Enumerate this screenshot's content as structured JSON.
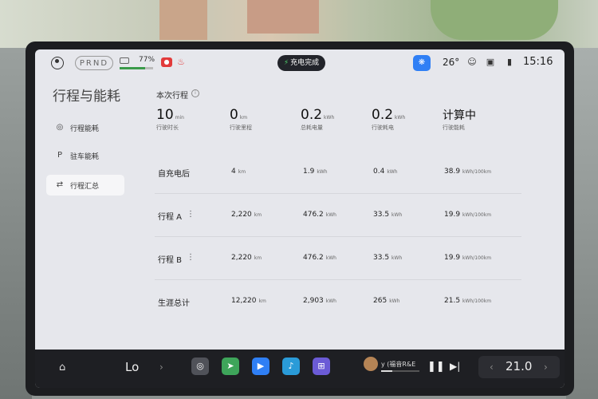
{
  "status_bar": {
    "gear": "PRND",
    "battery_percent": "77%",
    "battery_level": 0.77,
    "charge_status": "充电完成",
    "temperature": "26°",
    "time": "15:16",
    "accent_color": "#2f7ff5"
  },
  "sidebar": {
    "title": "行程与能耗",
    "items": [
      {
        "label": "行程能耗",
        "icon": "steering-wheel-icon"
      },
      {
        "label": "驻车能耗",
        "icon": "parking-icon"
      },
      {
        "label": "行程汇总",
        "icon": "swap-icon",
        "active": true
      }
    ]
  },
  "current_trip": {
    "title": "本次行程",
    "stats": [
      {
        "value": "10",
        "unit": "min",
        "label": "行驶时长"
      },
      {
        "value": "0",
        "unit": "km",
        "label": "行驶里程"
      },
      {
        "value": "0.2",
        "unit": "kWh",
        "label": "总耗电量"
      },
      {
        "value": "0.2",
        "unit": "kWh",
        "label": "行驶耗电"
      },
      {
        "value": "计算中",
        "unit": "",
        "label": "行驶能耗"
      }
    ]
  },
  "summary_rows": [
    {
      "name": "自充电后",
      "has_menu": false,
      "distance": "4",
      "distance_unit": "km",
      "energy": "1.9",
      "energy_unit": "kWh",
      "drive": "0.4",
      "drive_unit": "kWh",
      "rate": "38.9",
      "rate_unit": "kWh/100km"
    },
    {
      "name": "行程 A",
      "has_menu": true,
      "distance": "2,220",
      "distance_unit": "km",
      "energy": "476.2",
      "energy_unit": "kWh",
      "drive": "33.5",
      "drive_unit": "kWh",
      "rate": "19.9",
      "rate_unit": "kWh/100km"
    },
    {
      "name": "行程 B",
      "has_menu": true,
      "distance": "2,220",
      "distance_unit": "km",
      "energy": "476.2",
      "energy_unit": "kWh",
      "drive": "33.5",
      "drive_unit": "kWh",
      "rate": "19.9",
      "rate_unit": "kWh/100km"
    },
    {
      "name": "生涯总计",
      "has_menu": false,
      "distance": "12,220",
      "distance_unit": "km",
      "energy": "2,903",
      "energy_unit": "kWh",
      "drive": "265",
      "drive_unit": "kWh",
      "rate": "21.5",
      "rate_unit": "kWh/100km"
    }
  ],
  "dock": {
    "mode_label": "Lo",
    "media_title": "y (福音R&E",
    "media_progress": 0.3,
    "climate_temp": "21.0"
  }
}
